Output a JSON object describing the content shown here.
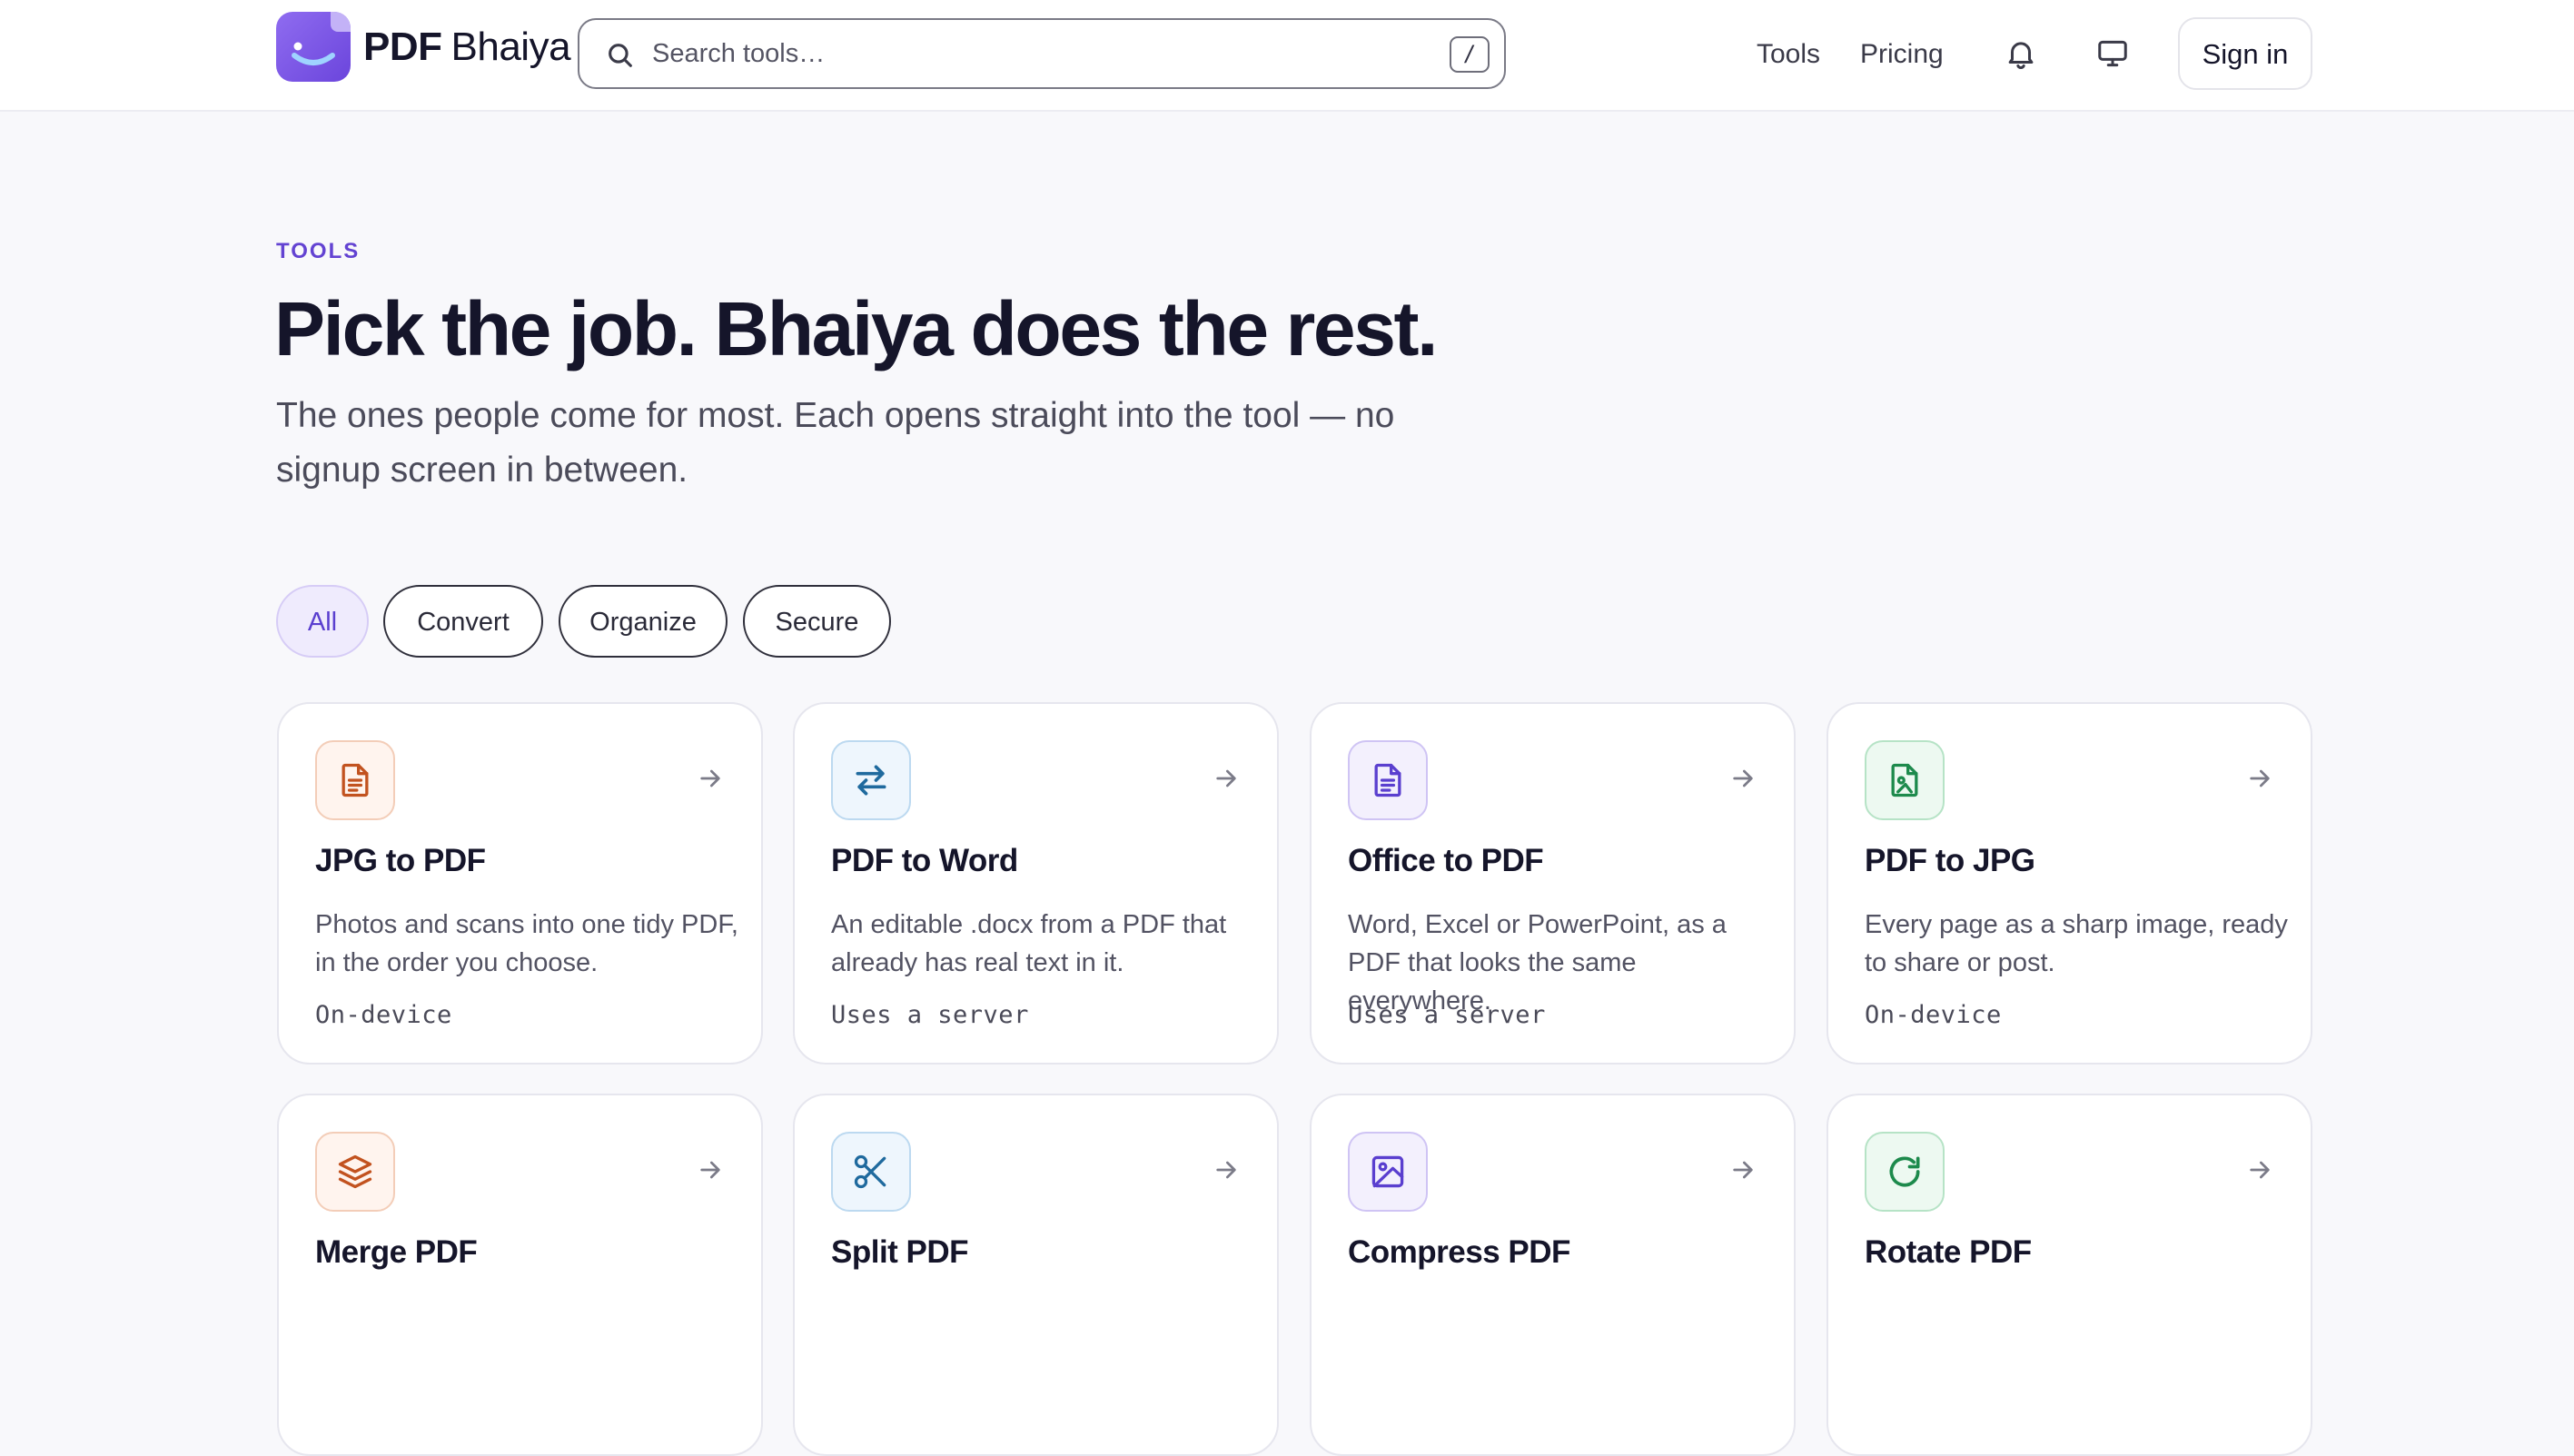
{
  "header": {
    "brand_bold": "PDF",
    "brand_regular": "Bhaiya",
    "search_placeholder": "Search tools…",
    "search_shortcut": "/",
    "nav": [
      "Tools",
      "Pricing"
    ],
    "signin_label": "Sign in"
  },
  "hero": {
    "eyebrow": "TOOLS",
    "title": "Pick the job. Bhaiya does the rest.",
    "subtitle": "The ones people come for most. Each opens straight into the tool — no signup screen in between."
  },
  "filters": [
    "All",
    "Convert",
    "Organize",
    "Secure"
  ],
  "active_filter": "All",
  "colors": {
    "accent": "#6343d2",
    "orange": "#c2521f",
    "blue": "#1f6a9e",
    "purple": "#5a3fcf",
    "green": "#1d8a4c"
  },
  "tools": [
    {
      "title": "JPG to PDF",
      "desc": "Photos and scans into one tidy PDF, in the order you choose.",
      "tag": "On-device",
      "icon": "document-icon"
    },
    {
      "title": "PDF to Word",
      "desc": "An editable .docx from a PDF that already has real text in it.",
      "tag": "Uses a server",
      "icon": "swap-arrows-icon"
    },
    {
      "title": "Office to PDF",
      "desc": "Word, Excel or PowerPoint, as a PDF that looks the same everywhere.",
      "tag": "Uses a server",
      "icon": "document-icon"
    },
    {
      "title": "PDF to JPG",
      "desc": "Every page as a sharp image, ready to share or post.",
      "tag": "On-device",
      "icon": "file-image-icon"
    },
    {
      "title": "Merge PDF",
      "desc": "",
      "tag": "",
      "icon": "layers-icon"
    },
    {
      "title": "Split PDF",
      "desc": "",
      "tag": "",
      "icon": "scissors-icon"
    },
    {
      "title": "Compress PDF",
      "desc": "",
      "tag": "",
      "icon": "image-icon"
    },
    {
      "title": "Rotate PDF",
      "desc": "",
      "tag": "",
      "icon": "rotate-icon"
    }
  ]
}
